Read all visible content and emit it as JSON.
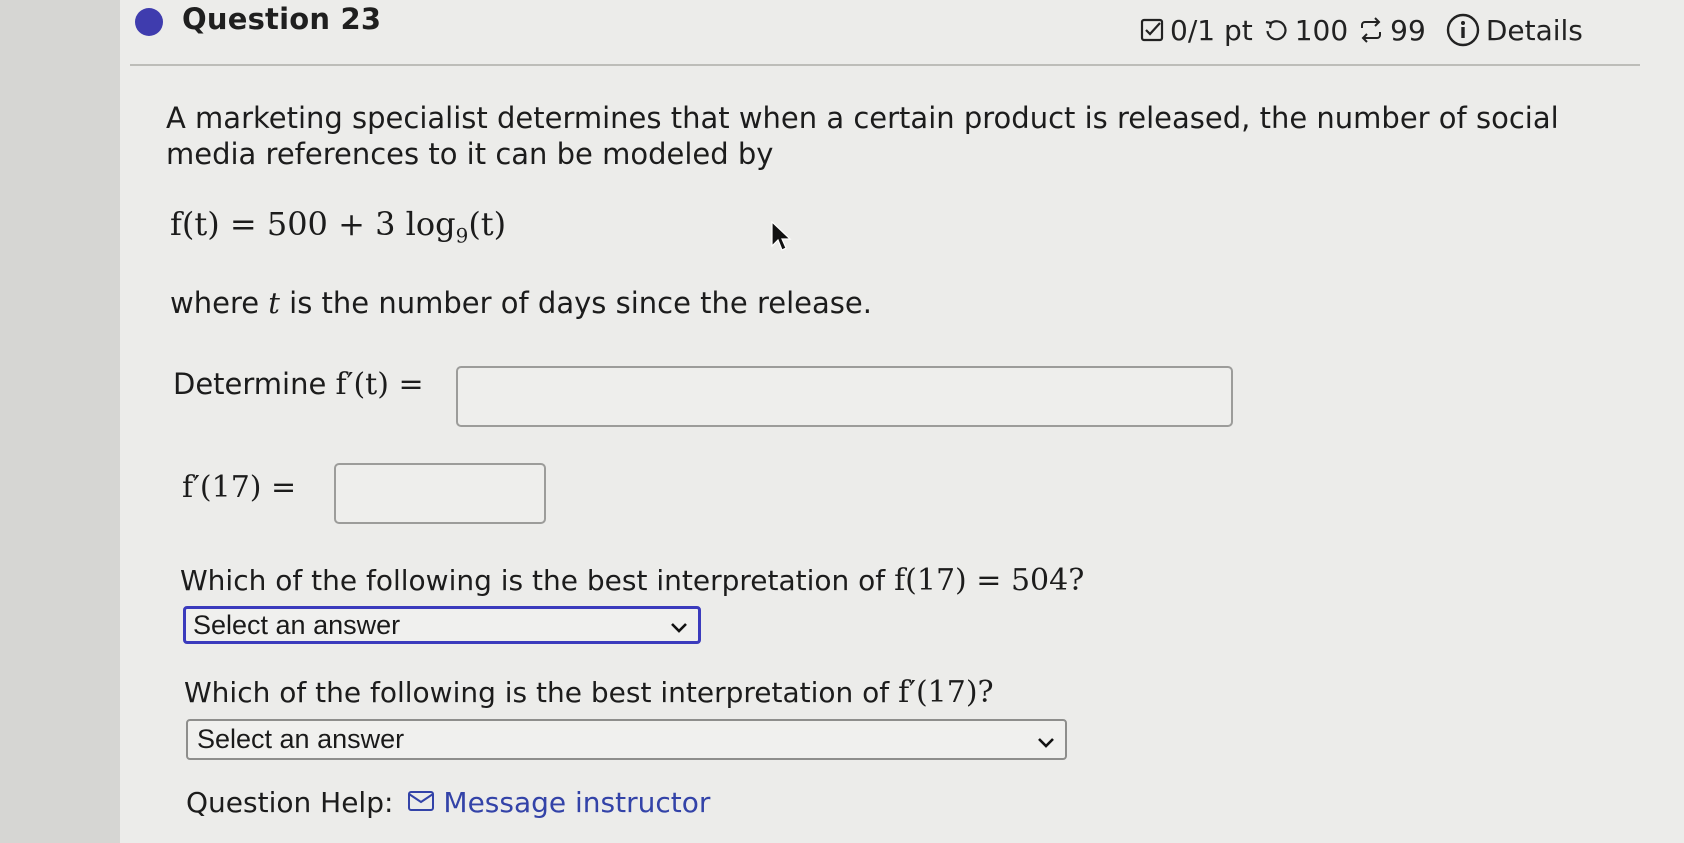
{
  "header": {
    "question_title": "Question 23",
    "score": "0/1 pt",
    "retries": "100",
    "attempts": "99",
    "details_label": "Details"
  },
  "problem": {
    "intro": "A marketing specialist determines that when a certain product is released, the number of social media references to it can be modeled by",
    "formula_lhs": "f(t) = 500 + 3 log",
    "formula_base": "9",
    "formula_rhs": "(t)",
    "where_prefix": "where ",
    "where_var": "t",
    "where_suffix": " is the number of days since the release."
  },
  "inputs": {
    "derivative_prefix": "Determine ",
    "derivative_label": "f′(t) =",
    "derivative_value": "",
    "f17_label": "f′(17) =",
    "f17_value": ""
  },
  "questions": {
    "q1_text": "Which of the following is the best interpretation of ",
    "q1_math": "f(17) = 504?",
    "q1_select": "Select an answer",
    "q2_text": "Which of the following is the best interpretation of ",
    "q2_math": "f′(17)?",
    "q2_select": "Select an answer"
  },
  "help": {
    "label": "Question Help:",
    "link": "Message instructor"
  },
  "colors": {
    "accent": "#3f3cae",
    "link": "#3343a8",
    "select_focus_border": "#3b3bbd"
  }
}
